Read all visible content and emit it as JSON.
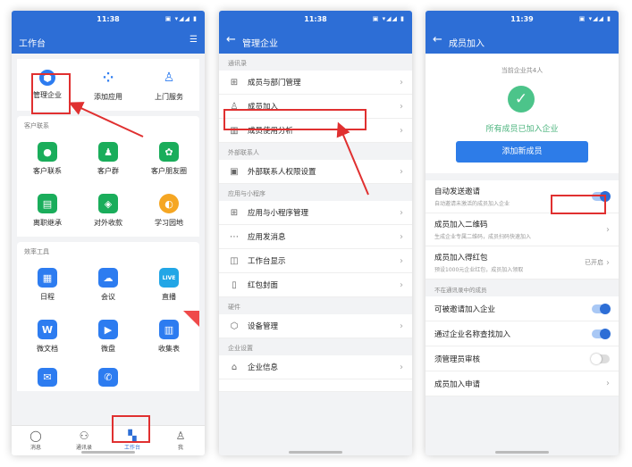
{
  "accent_color": "#2d6ed6",
  "highlight_color": "#e03030",
  "phone1": {
    "time": "11:38",
    "title": "工作台",
    "top_items": [
      {
        "label": "管理企业",
        "icon": "shield-gear-icon"
      },
      {
        "label": "添加应用",
        "icon": "apps-grid-icon"
      },
      {
        "label": "上门服务",
        "icon": "person-tie-icon"
      }
    ],
    "section_customer": "客户联系",
    "customer_items": [
      {
        "label": "客户联系",
        "icon": "chat-icon"
      },
      {
        "label": "客户群",
        "icon": "group-icon"
      },
      {
        "label": "客户朋友圈",
        "icon": "moments-icon"
      },
      {
        "label": "离职继承",
        "icon": "doc-icon"
      },
      {
        "label": "对外收款",
        "icon": "wallet-icon"
      },
      {
        "label": "学习园地",
        "icon": "planet-icon"
      }
    ],
    "section_tools": "效率工具",
    "tool_items": [
      {
        "label": "日程",
        "icon": "calendar-icon"
      },
      {
        "label": "会议",
        "icon": "camera-icon"
      },
      {
        "label": "直播",
        "icon": "live-icon",
        "glyph": "LIVE"
      },
      {
        "label": "微文档",
        "icon": "word-icon",
        "glyph": "W"
      },
      {
        "label": "微盘",
        "icon": "play-drive-icon"
      },
      {
        "label": "收集表",
        "icon": "form-icon"
      },
      {
        "label": "",
        "icon": "mail-icon"
      },
      {
        "label": "",
        "icon": "phone-icon"
      }
    ],
    "tabs": [
      {
        "label": "消息",
        "icon": "message-icon"
      },
      {
        "label": "通讯录",
        "icon": "contacts-icon"
      },
      {
        "label": "工作台",
        "icon": "workbench-icon"
      },
      {
        "label": "我",
        "icon": "me-icon"
      }
    ]
  },
  "phone2": {
    "time": "11:38",
    "title": "管理企业",
    "groups": [
      {
        "title": "通讯录",
        "rows": [
          {
            "label": "成员与部门管理",
            "icon": "org-tree-icon"
          },
          {
            "label": "成员加入",
            "icon": "add-member-icon"
          },
          {
            "label": "成员使用分析",
            "icon": "bar-chart-icon"
          }
        ]
      },
      {
        "title": "外部联系人",
        "rows": [
          {
            "label": "外部联系人权限设置",
            "icon": "contact-card-icon"
          }
        ]
      },
      {
        "title": "应用与小程序",
        "rows": [
          {
            "label": "应用与小程序管理",
            "icon": "apps-icon"
          },
          {
            "label": "应用发消息",
            "icon": "message-dots-icon"
          },
          {
            "label": "工作台显示",
            "icon": "display-icon"
          },
          {
            "label": "红包封面",
            "icon": "envelope-icon"
          }
        ]
      },
      {
        "title": "硬件",
        "rows": [
          {
            "label": "设备管理",
            "icon": "cube-icon"
          }
        ]
      },
      {
        "title": "企业设置",
        "rows": [
          {
            "label": "企业信息",
            "icon": "building-icon"
          }
        ]
      }
    ]
  },
  "phone3": {
    "time": "11:39",
    "title": "成员加入",
    "member_count": "当前企业共4人",
    "all_joined": "所有成员已加入企业",
    "add_button": "添加新成员",
    "settings": [
      {
        "title": "自动发送邀请",
        "subtitle": "自动邀请未激活的成员加入企业",
        "toggle": true
      },
      {
        "title": "成员加入二维码",
        "subtitle": "生成企业专属二维码，成员扫码快速加入",
        "chevron": true
      },
      {
        "title": "成员加入得红包",
        "subtitle": "预设1000元企业红包，成员加入领取",
        "value": "已开启",
        "chevron": true
      }
    ],
    "section_not_in": "不在通讯录中的成员",
    "not_in_rows": [
      {
        "title": "可被邀请加入企业",
        "toggle": true
      },
      {
        "title": "通过企业名称查找加入",
        "toggle": true
      },
      {
        "title": "须管理员审核",
        "toggle": false
      },
      {
        "title": "成员加入申请",
        "chevron": true
      }
    ]
  }
}
